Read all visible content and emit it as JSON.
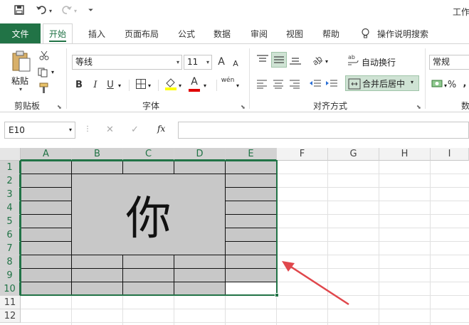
{
  "title": {
    "text": "工作"
  },
  "tabs": {
    "file": "文件",
    "items": [
      "开始",
      "插入",
      "页面布局",
      "公式",
      "数据",
      "审阅",
      "视图",
      "帮助"
    ],
    "tell_me": "操作说明搜索"
  },
  "ribbon": {
    "clipboard": {
      "paste": "粘贴",
      "label": "剪贴板"
    },
    "font": {
      "name": "等线",
      "size": "11",
      "bold": "B",
      "italic": "I",
      "underline": "U",
      "font_color_glyph": "A",
      "phonetic_glyph": "wén",
      "label": "字体",
      "grow": "A",
      "shrink": "A"
    },
    "alignment": {
      "wrap_text": "自动换行",
      "merge_center": "合并后居中",
      "label": "对齐方式"
    },
    "number": {
      "format": "常规",
      "percent": "%",
      "comma": ",",
      "label": "数"
    }
  },
  "formula_bar": {
    "name_box": "E10",
    "fx": "fx",
    "cancel": "✕",
    "confirm": "✓",
    "value": ""
  },
  "columns": [
    "A",
    "B",
    "C",
    "D",
    "E",
    "F",
    "G",
    "H",
    "I"
  ],
  "rows": [
    "1",
    "2",
    "3",
    "4",
    "5",
    "6",
    "7",
    "8",
    "9",
    "10",
    "11",
    "12"
  ],
  "merged_cell": {
    "text": "你"
  },
  "colors": {
    "accent": "#217346",
    "cell_fill": "#c8c8c8",
    "arrow": "#e0474c"
  }
}
